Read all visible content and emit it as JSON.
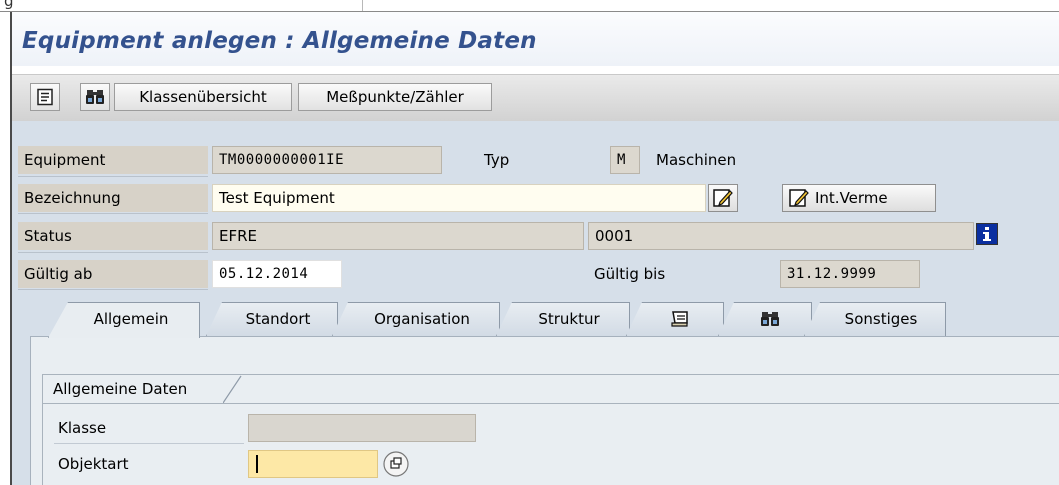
{
  "menu_fragment": "g",
  "title": "Equipment anlegen : Allgemeine Daten",
  "toolbar": {
    "buttons": [
      {
        "icon": "document-list-icon"
      },
      {
        "icon": "binoculars-icon"
      },
      {
        "label": "Klassenübersicht"
      },
      {
        "label": "Meßpunkte/Zähler"
      }
    ]
  },
  "header": {
    "equipment_label": "Equipment",
    "equipment_value": "TM0000000001IE",
    "typ_label": "Typ",
    "typ_value": "M",
    "typ_text": "Maschinen",
    "bezeichnung_label": "Bezeichnung",
    "bezeichnung_value": "Test Equipment",
    "int_verme_label": "Int.Verme",
    "status_label": "Status",
    "status_value": "EFRE",
    "status_code": "0001",
    "gueltig_ab_label": "Gültig ab",
    "gueltig_ab_value": "05.12.2014",
    "gueltig_bis_label": "Gültig bis",
    "gueltig_bis_value": "31.12.9999"
  },
  "tabs": [
    {
      "label": "Allgemein",
      "active": true
    },
    {
      "label": "Standort"
    },
    {
      "label": "Organisation"
    },
    {
      "label": "Struktur"
    },
    {
      "icon": "scroll-icon"
    },
    {
      "icon": "binoculars-icon"
    },
    {
      "label": "Sonstiges"
    }
  ],
  "group": {
    "title": "Allgemeine Daten",
    "klasse_label": "Klasse",
    "klasse_value": "",
    "objektart_label": "Objektart",
    "objektart_value": ""
  },
  "colors": {
    "title": "#34528e",
    "body_bg": "#d6dfe9",
    "required_field": "#fde8a6"
  }
}
